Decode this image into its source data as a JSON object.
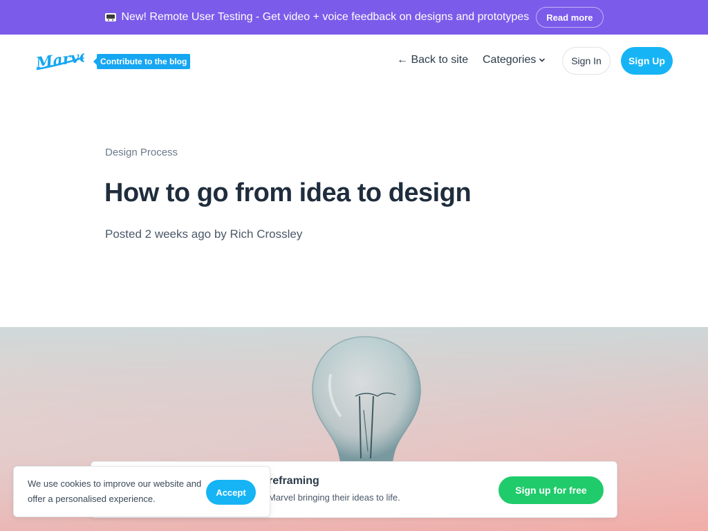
{
  "announcement": {
    "icon": "video-camera-icon",
    "text": "New! Remote User Testing - Get video + voice feedback on designs and prototypes",
    "read_more": "Read more",
    "background": "#7b5bea"
  },
  "header": {
    "logo_text": "Marvel",
    "contribute": "Contribute to the blog",
    "back_to_site": "← Back to site",
    "categories": "Categories",
    "sign_in": "Sign In",
    "sign_up": "Sign Up"
  },
  "article": {
    "category": "Design Process",
    "title": "How to go from idea to design",
    "byline": "Posted 2 weeks ago by Rich Crossley"
  },
  "promo": {
    "title": "reframing",
    "subtitle": "Marvel bringing their ideas to life.",
    "cta": "Sign up for free"
  },
  "cookie": {
    "text": "We use cookies to improve our website and offer a personalised experience.",
    "accept": "Accept"
  },
  "colors": {
    "accent_blue": "#16b4f5",
    "cta_green": "#1fcb6a",
    "title_dark": "#1f2d3d"
  }
}
